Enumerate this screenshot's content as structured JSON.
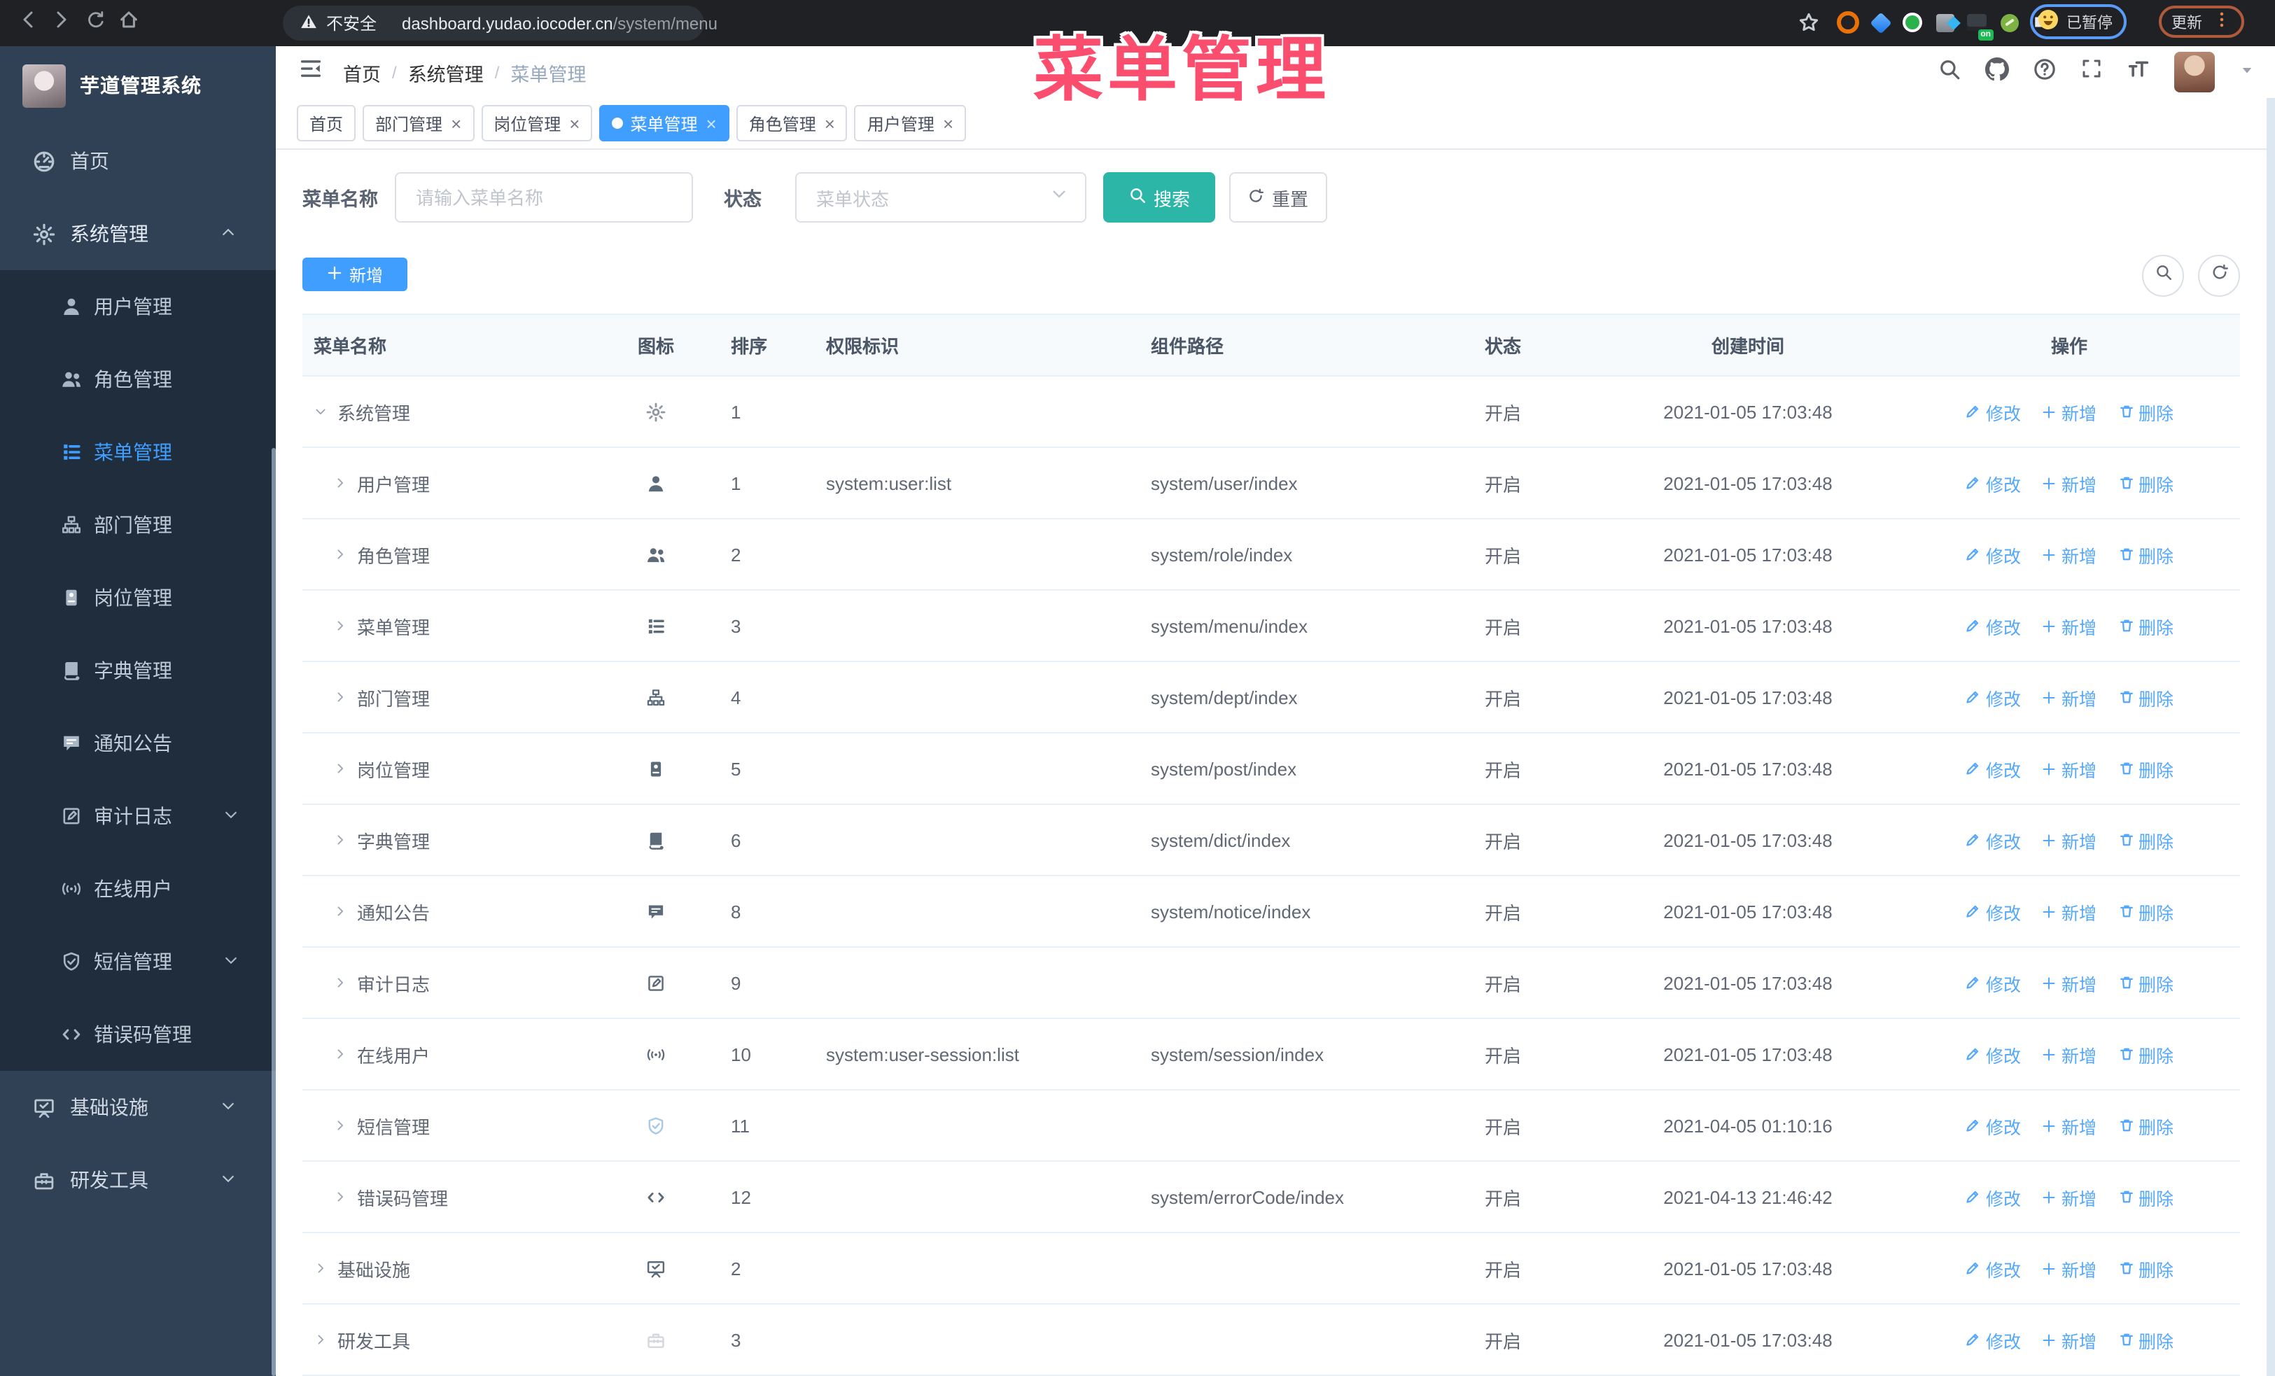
{
  "browser": {
    "security": "不安全",
    "host": "dashboard.yudao.iocoder.cn",
    "path": "/system/menu",
    "paused": "已暂停",
    "update": "更新",
    "ext_badge": "on"
  },
  "annotation": {
    "text": "菜单管理",
    "color": "#fb4d6d"
  },
  "sidebar": {
    "app_title": "芋道管理系统",
    "menu": [
      {
        "key": "home",
        "label": "首页",
        "icon": "dashboard",
        "level": 0
      },
      {
        "key": "system",
        "label": "系统管理",
        "icon": "gear",
        "level": 0,
        "arrow": "up",
        "open": true,
        "children": [
          {
            "key": "user",
            "label": "用户管理",
            "icon": "user"
          },
          {
            "key": "role",
            "label": "角色管理",
            "icon": "users"
          },
          {
            "key": "menu",
            "label": "菜单管理",
            "icon": "menutree",
            "active": true
          },
          {
            "key": "dept",
            "label": "部门管理",
            "icon": "orgtree"
          },
          {
            "key": "post",
            "label": "岗位管理",
            "icon": "badge"
          },
          {
            "key": "dict",
            "label": "字典管理",
            "icon": "book"
          },
          {
            "key": "notice",
            "label": "通知公告",
            "icon": "chat"
          },
          {
            "key": "audit",
            "label": "审计日志",
            "icon": "audit",
            "arrow": "down"
          },
          {
            "key": "online",
            "label": "在线用户",
            "icon": "signal"
          },
          {
            "key": "sms",
            "label": "短信管理",
            "icon": "shield",
            "arrow": "down"
          },
          {
            "key": "errcode",
            "label": "错误码管理",
            "icon": "errcode"
          }
        ]
      },
      {
        "key": "infra",
        "label": "基础设施",
        "icon": "board",
        "level": 0,
        "arrow": "down"
      },
      {
        "key": "tools",
        "label": "研发工具",
        "icon": "toolbox",
        "level": 0,
        "arrow": "down"
      }
    ]
  },
  "header": {
    "breadcrumb": [
      "首页",
      "系统管理",
      "菜单管理"
    ]
  },
  "tabs": {
    "items": [
      {
        "key": "home",
        "label": "首页",
        "closable": false,
        "active": false
      },
      {
        "key": "dept",
        "label": "部门管理",
        "closable": true,
        "active": false
      },
      {
        "key": "post",
        "label": "岗位管理",
        "closable": true,
        "active": false
      },
      {
        "key": "menu",
        "label": "菜单管理",
        "closable": true,
        "active": true
      },
      {
        "key": "role",
        "label": "角色管理",
        "closable": true,
        "active": false
      },
      {
        "key": "user",
        "label": "用户管理",
        "closable": true,
        "active": false
      }
    ]
  },
  "filters": {
    "name_label": "菜单名称",
    "name_placeholder": "请输入菜单名称",
    "status_label": "状态",
    "status_placeholder": "菜单状态",
    "search_label": "搜索",
    "reset_label": "重置"
  },
  "toolbar": {
    "add_label": "新增"
  },
  "table": {
    "columns": [
      "菜单名称",
      "图标",
      "排序",
      "权限标识",
      "组件路径",
      "状态",
      "创建时间",
      "操作"
    ],
    "ops": {
      "edit": "修改",
      "add": "新增",
      "del": "删除"
    },
    "rows": [
      {
        "key": "system",
        "name": "系统管理",
        "level": 0,
        "expanded": true,
        "icon": "gear",
        "tone": "muted",
        "sort": "1",
        "perm": "",
        "path": "",
        "status": "开启",
        "time": "2021-01-05 17:03:48"
      },
      {
        "key": "user",
        "name": "用户管理",
        "level": 1,
        "expanded": false,
        "icon": "user",
        "tone": "dark",
        "sort": "1",
        "perm": "system:user:list",
        "path": "system/user/index",
        "status": "开启",
        "time": "2021-01-05 17:03:48"
      },
      {
        "key": "role",
        "name": "角色管理",
        "level": 1,
        "expanded": false,
        "icon": "users",
        "tone": "dark",
        "sort": "2",
        "perm": "",
        "path": "system/role/index",
        "status": "开启",
        "time": "2021-01-05 17:03:48"
      },
      {
        "key": "menu",
        "name": "菜单管理",
        "level": 1,
        "expanded": false,
        "icon": "menutree",
        "tone": "dark",
        "sort": "3",
        "perm": "",
        "path": "system/menu/index",
        "status": "开启",
        "time": "2021-01-05 17:03:48"
      },
      {
        "key": "dept",
        "name": "部门管理",
        "level": 1,
        "expanded": false,
        "icon": "orgtree",
        "tone": "dark",
        "sort": "4",
        "perm": "",
        "path": "system/dept/index",
        "status": "开启",
        "time": "2021-01-05 17:03:48"
      },
      {
        "key": "post",
        "name": "岗位管理",
        "level": 1,
        "expanded": false,
        "icon": "badge",
        "tone": "dark",
        "sort": "5",
        "perm": "",
        "path": "system/post/index",
        "status": "开启",
        "time": "2021-01-05 17:03:48"
      },
      {
        "key": "dict",
        "name": "字典管理",
        "level": 1,
        "expanded": false,
        "icon": "book",
        "tone": "dark",
        "sort": "6",
        "perm": "",
        "path": "system/dict/index",
        "status": "开启",
        "time": "2021-01-05 17:03:48"
      },
      {
        "key": "notice",
        "name": "通知公告",
        "level": 1,
        "expanded": false,
        "icon": "chat",
        "tone": "dark",
        "sort": "8",
        "perm": "",
        "path": "system/notice/index",
        "status": "开启",
        "time": "2021-01-05 17:03:48"
      },
      {
        "key": "audit",
        "name": "审计日志",
        "level": 1,
        "expanded": false,
        "icon": "audit",
        "tone": "dark",
        "sort": "9",
        "perm": "",
        "path": "",
        "status": "开启",
        "time": "2021-01-05 17:03:48"
      },
      {
        "key": "online",
        "name": "在线用户",
        "level": 1,
        "expanded": false,
        "icon": "signal",
        "tone": "dark",
        "sort": "10",
        "perm": "system:user-session:list",
        "path": "system/session/index",
        "status": "开启",
        "time": "2021-01-05 17:03:48"
      },
      {
        "key": "sms",
        "name": "短信管理",
        "level": 1,
        "expanded": false,
        "icon": "shield",
        "tone": "lightblue",
        "sort": "11",
        "perm": "",
        "path": "",
        "status": "开启",
        "time": "2021-04-05 01:10:16"
      },
      {
        "key": "errcode",
        "name": "错误码管理",
        "level": 1,
        "expanded": false,
        "icon": "errcode",
        "tone": "dark",
        "sort": "12",
        "perm": "",
        "path": "system/errorCode/index",
        "status": "开启",
        "time": "2021-04-13 21:46:42"
      },
      {
        "key": "infra",
        "name": "基础设施",
        "level": 0,
        "expanded": false,
        "icon": "board",
        "tone": "dark",
        "sort": "2",
        "perm": "",
        "path": "",
        "status": "开启",
        "time": "2021-01-05 17:03:48"
      },
      {
        "key": "tools",
        "name": "研发工具",
        "level": 0,
        "expanded": false,
        "icon": "toolbox",
        "tone": "faint",
        "sort": "3",
        "perm": "",
        "path": "",
        "status": "开启",
        "time": "2021-01-05 17:03:48"
      }
    ]
  }
}
